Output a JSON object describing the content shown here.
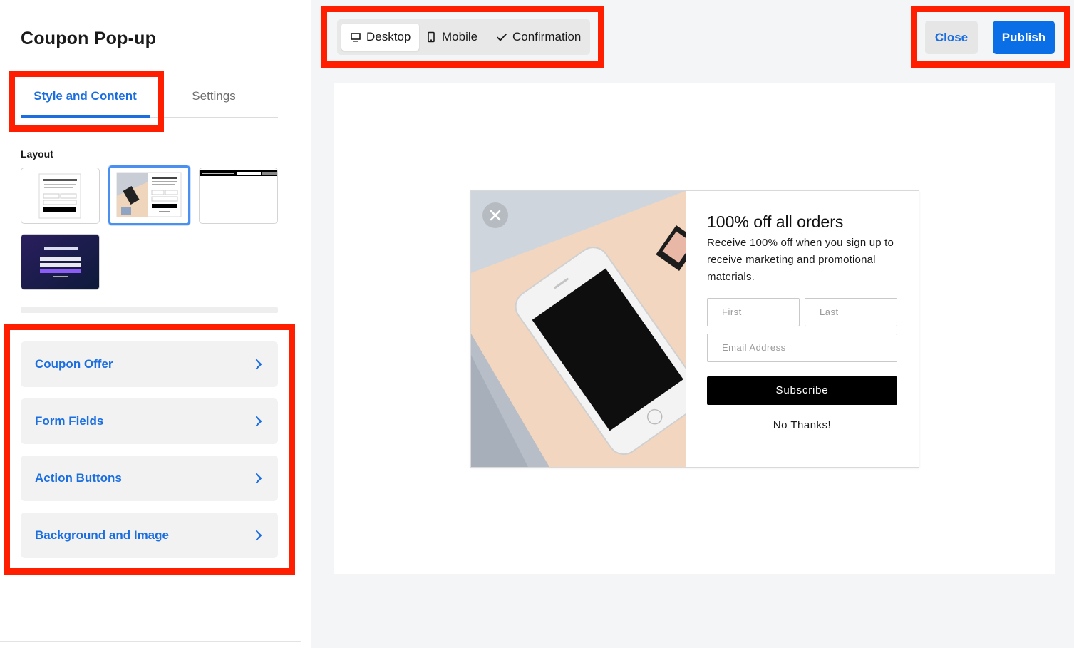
{
  "sidebar": {
    "title": "Coupon Pop-up",
    "tabs": [
      {
        "label": "Style and Content",
        "active": true
      },
      {
        "label": "Settings",
        "active": false
      }
    ],
    "layout_label": "Layout",
    "accordion": [
      {
        "label": "Coupon Offer"
      },
      {
        "label": "Form Fields"
      },
      {
        "label": "Action Buttons"
      },
      {
        "label": "Background and Image"
      }
    ]
  },
  "toolbar": {
    "views": [
      {
        "label": "Desktop",
        "icon": "desktop-icon",
        "active": true
      },
      {
        "label": "Mobile",
        "icon": "mobile-icon",
        "active": false
      },
      {
        "label": "Confirmation",
        "icon": "check-icon",
        "active": false
      }
    ],
    "close_label": "Close",
    "publish_label": "Publish"
  },
  "popup": {
    "title": "100% off all orders",
    "description": "Receive 100% off when you sign up to receive marketing and promotional materials.",
    "first_placeholder": "First",
    "last_placeholder": "Last",
    "email_placeholder": "Email Address",
    "subscribe_label": "Subscribe",
    "no_thanks_label": "No Thanks!"
  },
  "colors": {
    "accent": "#1a6ee0",
    "publish": "#0a6ee6",
    "annotation": "#ff1f00"
  }
}
